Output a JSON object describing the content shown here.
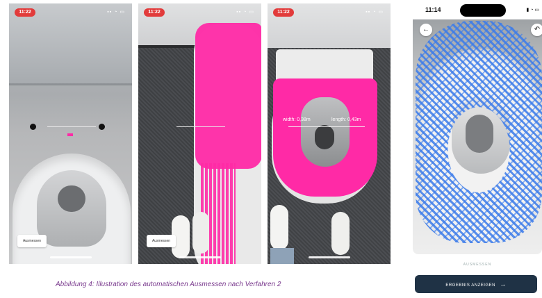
{
  "caption": "Abbildung 4: Illustration des automatischen Ausmessen nach Verfahren 2",
  "screens": [
    {
      "time": "11:22",
      "button": "Ausmessen"
    },
    {
      "time": "11:22",
      "button": "Ausmessen"
    },
    {
      "time": "11:22",
      "width_label": "width: 0,38m",
      "length_label": "length: 0,43m"
    }
  ],
  "right_phone": {
    "time": "11:14",
    "back_icon": "arrow-left-icon",
    "undo_icon": "undo-icon",
    "bottom_label": "AUSMESSEN",
    "result_button": "ERGEBNIS ANZEIGEN",
    "result_icon": "arrow-right-icon"
  },
  "colors": {
    "overlay_pink": "#ff2aa6",
    "overlay_blue": "#3b7bea",
    "recording_pill": "#e23b3b",
    "button_dark": "#1f3245"
  }
}
